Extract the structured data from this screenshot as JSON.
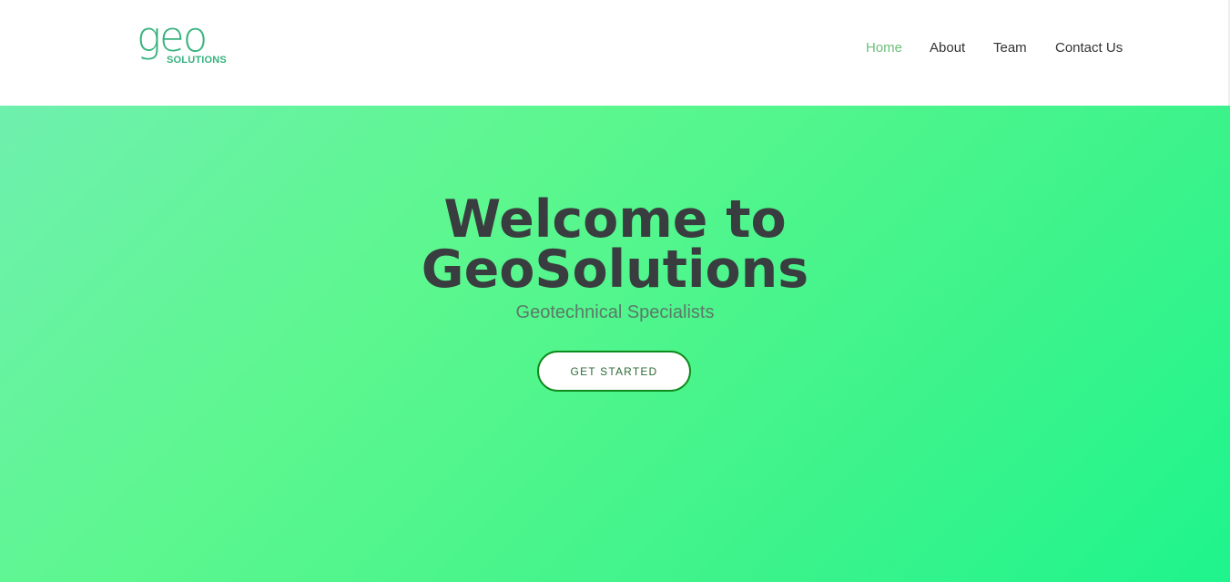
{
  "logo": {
    "mark": "geo",
    "sub": "SOLUTIONS"
  },
  "nav": {
    "items": [
      {
        "label": "Home",
        "active": true
      },
      {
        "label": "About",
        "active": false
      },
      {
        "label": "Team",
        "active": false
      },
      {
        "label": "Contact Us",
        "active": false
      }
    ]
  },
  "hero": {
    "title_line1": "Welcome to",
    "title_line2": "GeoSolutions",
    "subtitle": "Geotechnical Specialists",
    "cta_label": "GET STARTED"
  },
  "colors": {
    "brand": "#36b37e",
    "nav_active": "#6dbf7a",
    "title": "#3a3d3f",
    "cta_border": "#0f8a1c",
    "hero_gradient_start": "#6ff0ae",
    "hero_gradient_end": "#1ff48c"
  }
}
